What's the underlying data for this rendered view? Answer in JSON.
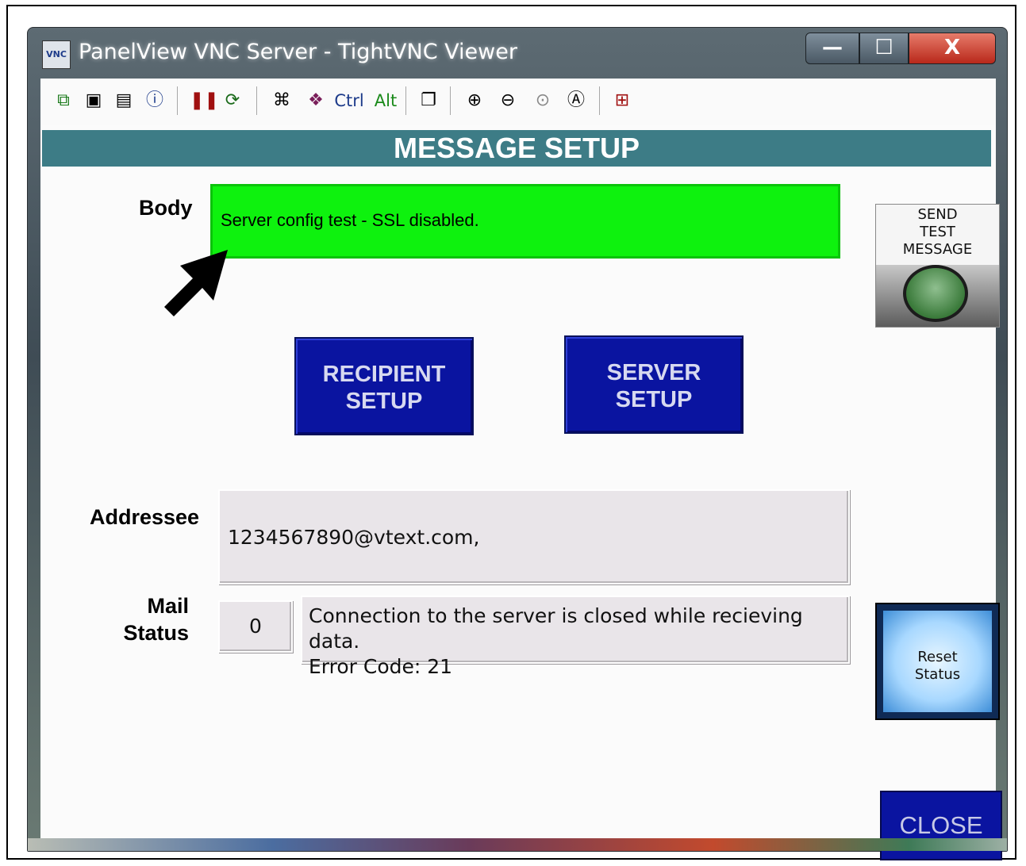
{
  "window": {
    "title": "PanelView VNC Server - TightVNC Viewer",
    "app_icon_label": "VNC",
    "minimize_glyph": "—",
    "maximize_glyph": "☐",
    "close_glyph": "X"
  },
  "toolbar": {
    "ctrl_label": "Ctrl",
    "alt_label": "Alt",
    "icons": [
      "new-connection-icon",
      "save-icon",
      "options-icon",
      "info-icon",
      "pause-icon",
      "refresh-icon",
      "send-ctrl-alt-del-icon",
      "send-ctrl-esc-icon",
      "ctrl-key-icon",
      "alt-key-icon",
      "clipboard-icon",
      "zoom-in-icon",
      "zoom-out-icon",
      "zoom-100-icon",
      "zoom-auto-icon",
      "fullscreen-icon"
    ]
  },
  "screen": {
    "header": "MESSAGE SETUP",
    "body_label": "Body",
    "body_value": "Server config test - SSL disabled.",
    "recipient_button": [
      "RECIPIENT",
      "SETUP"
    ],
    "server_button": [
      "SERVER",
      "SETUP"
    ],
    "send_test": [
      "SEND",
      "TEST",
      "MESSAGE"
    ],
    "addressee_label": "Addressee",
    "addressee_value": "1234567890@vtext.com,",
    "mail_status_label": [
      "Mail",
      "Status"
    ],
    "status_code": "0",
    "status_message": [
      "Connection to the server is closed while recieving data.",
      "Error Code: 21"
    ],
    "reset_button": [
      "Reset",
      "Status"
    ],
    "close_button": "CLOSE"
  },
  "colors": {
    "header_bg": "#3d7c86",
    "body_field_bg": "#0ef20e",
    "nav_button_bg": "#0a14a0"
  }
}
